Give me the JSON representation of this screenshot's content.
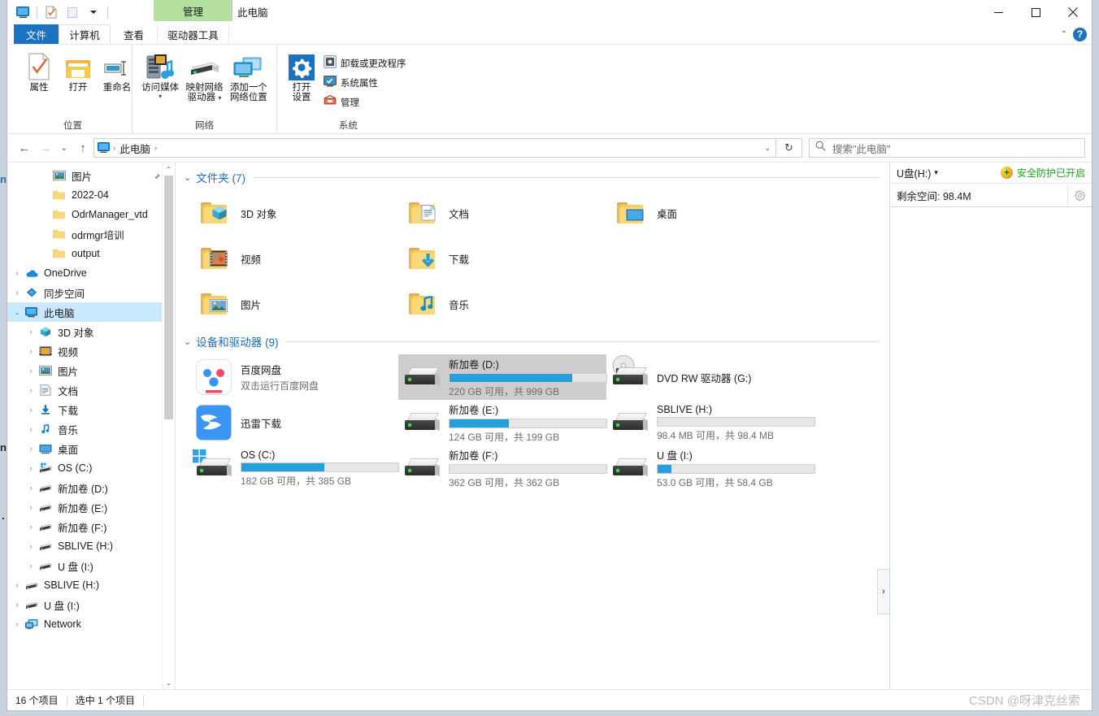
{
  "window": {
    "context_tab": "管理",
    "title": "此电脑",
    "minimize": "—",
    "maximize": "□",
    "close": "✕"
  },
  "quick_access": {
    "icons": [
      "this-pc-icon",
      "properties-icon",
      "new-folder-icon",
      "customize-caret-icon"
    ]
  },
  "tabs": [
    {
      "label": "文件",
      "id": "file"
    },
    {
      "label": "计算机",
      "id": "computer"
    },
    {
      "label": "查看",
      "id": "view"
    },
    {
      "label": "驱动器工具",
      "id": "drive-tools"
    }
  ],
  "tab_right": {
    "collapse": "⌃",
    "help": "?"
  },
  "ribbon": {
    "groups": [
      {
        "name": "位置",
        "buttons": [
          {
            "label": "属性",
            "icon": "properties-icon"
          },
          {
            "label": "打开",
            "icon": "open-folder-icon"
          },
          {
            "label": "重命名",
            "icon": "rename-icon"
          }
        ]
      },
      {
        "name": "网络",
        "buttons": [
          {
            "label": "访问媒体",
            "icon": "media-server-icon",
            "dropdown": true
          },
          {
            "label": "映射网络\n驱动器",
            "icon": "map-drive-icon",
            "dropdown": true
          },
          {
            "label": "添加一个\n网络位置",
            "icon": "add-network-location-icon"
          }
        ]
      },
      {
        "name": "系统",
        "big": [
          {
            "label": "打开\n设置",
            "icon": "settings-gear-icon"
          }
        ],
        "small": [
          {
            "label": "卸载或更改程序",
            "icon": "uninstall-program-icon"
          },
          {
            "label": "系统属性",
            "icon": "system-properties-icon"
          },
          {
            "label": "管理",
            "icon": "computer-management-icon"
          }
        ]
      }
    ]
  },
  "address": {
    "back": "←",
    "forward": "→",
    "history": "⌄",
    "up": "↑",
    "crumbs": [
      "此电脑"
    ],
    "refresh": "↻",
    "search_placeholder": "搜索\"此电脑\""
  },
  "nav_pane": {
    "items": [
      {
        "label": "图片",
        "icon": "pictures-icon",
        "indent": 2,
        "chevron": "",
        "pinned": true
      },
      {
        "label": "2022-04",
        "icon": "folder-icon",
        "indent": 2,
        "chevron": ""
      },
      {
        "label": "OdrManager_vtd",
        "icon": "folder-icon",
        "indent": 2,
        "chevron": ""
      },
      {
        "label": "odrmgr培训",
        "icon": "folder-icon",
        "indent": 2,
        "chevron": ""
      },
      {
        "label": "output",
        "icon": "folder-icon",
        "indent": 2,
        "chevron": ""
      },
      {
        "label": "OneDrive",
        "icon": "onedrive-icon",
        "indent": 0,
        "chevron": "›"
      },
      {
        "label": "同步空间",
        "icon": "sync-space-icon",
        "indent": 0,
        "chevron": "›"
      },
      {
        "label": "此电脑",
        "icon": "this-pc-icon",
        "indent": 0,
        "chevron": "⌄",
        "selected": true
      },
      {
        "label": "3D 对象",
        "icon": "3d-objects-icon",
        "indent": 1,
        "chevron": "›"
      },
      {
        "label": "视频",
        "icon": "videos-icon",
        "indent": 1,
        "chevron": "›"
      },
      {
        "label": "图片",
        "icon": "pictures-icon",
        "indent": 1,
        "chevron": "›"
      },
      {
        "label": "文档",
        "icon": "documents-icon",
        "indent": 1,
        "chevron": "›"
      },
      {
        "label": "下载",
        "icon": "downloads-icon",
        "indent": 1,
        "chevron": "›"
      },
      {
        "label": "音乐",
        "icon": "music-icon",
        "indent": 1,
        "chevron": "›"
      },
      {
        "label": "桌面",
        "icon": "desktop-icon",
        "indent": 1,
        "chevron": "›"
      },
      {
        "label": "OS (C:)",
        "icon": "os-drive-icon",
        "indent": 1,
        "chevron": "›"
      },
      {
        "label": "新加卷 (D:)",
        "icon": "drive-icon",
        "indent": 1,
        "chevron": "›"
      },
      {
        "label": "新加卷 (E:)",
        "icon": "drive-icon",
        "indent": 1,
        "chevron": "›"
      },
      {
        "label": "新加卷 (F:)",
        "icon": "drive-icon",
        "indent": 1,
        "chevron": "›"
      },
      {
        "label": "SBLIVE (H:)",
        "icon": "drive-icon",
        "indent": 1,
        "chevron": "›"
      },
      {
        "label": "U 盘 (I:)",
        "icon": "drive-icon",
        "indent": 1,
        "chevron": "›"
      },
      {
        "label": "SBLIVE (H:)",
        "icon": "drive-icon",
        "indent": 0,
        "chevron": "›"
      },
      {
        "label": "U 盘 (I:)",
        "icon": "drive-icon",
        "indent": 0,
        "chevron": "›"
      },
      {
        "label": "Network",
        "icon": "network-icon",
        "indent": 0,
        "chevron": "›"
      }
    ]
  },
  "content": {
    "groups": [
      {
        "header": "文件夹 (7)",
        "chevron": "⌄",
        "items": [
          {
            "name": "3D 对象",
            "icon": "folder-3d-objects-icon",
            "type": "folder"
          },
          {
            "name": "视频",
            "icon": "folder-videos-icon",
            "type": "folder"
          },
          {
            "name": "图片",
            "icon": "folder-pictures-icon",
            "type": "folder"
          },
          {
            "name": "文档",
            "icon": "folder-documents-icon",
            "type": "folder"
          },
          {
            "name": "下载",
            "icon": "folder-downloads-icon",
            "type": "folder"
          },
          {
            "name": "音乐",
            "icon": "folder-music-icon",
            "type": "folder"
          },
          {
            "name": "桌面",
            "icon": "folder-desktop-icon",
            "type": "folder"
          }
        ]
      },
      {
        "header": "设备和驱动器 (9)",
        "chevron": "⌄",
        "items": [
          {
            "name": "百度网盘",
            "sub": "双击运行百度网盘",
            "icon": "baidu-netdisk-icon",
            "type": "app"
          },
          {
            "name": "迅雷下载",
            "sub": "",
            "icon": "thunder-download-icon",
            "type": "app"
          },
          {
            "name": "OS (C:)",
            "sub": "182 GB 可用，共 385 GB",
            "icon": "os-drive-icon",
            "type": "drive",
            "used_pct": 53
          },
          {
            "name": "新加卷 (D:)",
            "sub": "220 GB 可用，共 999 GB",
            "icon": "drive-icon",
            "type": "drive",
            "used_pct": 78,
            "selected": true
          },
          {
            "name": "新加卷 (E:)",
            "sub": "124 GB 可用，共 199 GB",
            "icon": "drive-icon",
            "type": "drive",
            "used_pct": 38
          },
          {
            "name": "新加卷 (F:)",
            "sub": "362 GB 可用，共 362 GB",
            "icon": "drive-icon",
            "type": "drive",
            "used_pct": 0
          },
          {
            "name": "DVD RW 驱动器 (G:)",
            "sub": "",
            "icon": "dvd-drive-icon",
            "type": "optical"
          },
          {
            "name": "SBLIVE (H:)",
            "sub": "98.4 MB 可用，共 98.4 MB",
            "icon": "drive-icon",
            "type": "drive",
            "used_pct": 0
          },
          {
            "name": "U 盘 (I:)",
            "sub": "53.0 GB 可用，共 58.4 GB",
            "icon": "drive-icon",
            "type": "drive",
            "used_pct": 9
          }
        ]
      }
    ],
    "splitter_arrow": "›"
  },
  "right_pane": {
    "drive_label": "U盘(H:)",
    "drive_caret": "▾",
    "protection_status": "安全防护已开启",
    "shield_icon": "+",
    "free_space": "剩余空间: 98.4M",
    "gear_icon": "gear-icon"
  },
  "status_bar": {
    "item_count": "16 个项目",
    "selection": "选中 1 个项目",
    "watermark": "CSDN @呀津克丝索"
  },
  "colors": {
    "accent": "#1b72c2",
    "bar_fill": "#26a0da",
    "context_tab": "#b4e0a0",
    "group_header": "#1a6fc4",
    "selection": "#cce8ff",
    "safe_green": "#18a318"
  }
}
